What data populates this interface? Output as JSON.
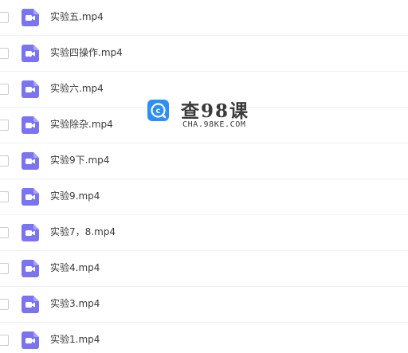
{
  "files": [
    {
      "name": "实验五.mp4",
      "icon": "video-file-icon"
    },
    {
      "name": "实验四操作.mp4",
      "icon": "video-file-icon"
    },
    {
      "name": "实验六.mp4",
      "icon": "video-file-icon"
    },
    {
      "name": "实验除杂.mp4",
      "icon": "video-file-icon"
    },
    {
      "name": "实验9下.mp4",
      "icon": "video-file-icon"
    },
    {
      "name": "实验9.mp4",
      "icon": "video-file-icon"
    },
    {
      "name": "实验7，8.mp4",
      "icon": "video-file-icon"
    },
    {
      "name": "实验4.mp4",
      "icon": "video-file-icon"
    },
    {
      "name": "实验3.mp4",
      "icon": "video-file-icon"
    },
    {
      "name": "实验1.mp4",
      "icon": "video-file-icon"
    }
  ],
  "watermark": {
    "title": "查98课",
    "url": "CHA.98KE.COM"
  },
  "colors": {
    "icon_purple": "#7a73f2",
    "logo_blue": "#2a8ff7",
    "row_divider": "#eef0f3",
    "text": "#3a3a3a"
  }
}
